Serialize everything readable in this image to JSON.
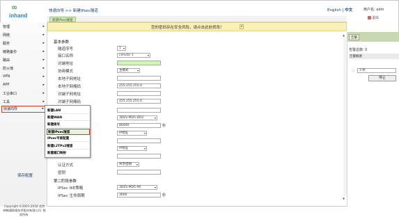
{
  "header": {
    "breadcrumb": "快速向导 >> 新建IPsec隧道",
    "tab": "新建IPsec隧道",
    "lang_en": "English",
    "lang_sep": "|",
    "lang_zh": "中文",
    "user": "用户名: adm",
    "logout": "退出"
  },
  "logo": {
    "mark": "∞",
    "brand": "inhand"
  },
  "warning": {
    "text": "您的密码存在安全风险，请点击此处修改！",
    "close": "×"
  },
  "sidebar": {
    "items": [
      {
        "label": "管理",
        "arrow": "▸"
      },
      {
        "label": "网络",
        "arrow": "▸"
      },
      {
        "label": "服务",
        "arrow": "▸"
      },
      {
        "label": "链路备份",
        "arrow": "▸"
      },
      {
        "label": "路由",
        "arrow": "▸"
      },
      {
        "label": "防火墙",
        "arrow": "▸"
      },
      {
        "label": "VPN",
        "arrow": "▸"
      },
      {
        "label": "APP",
        "arrow": "▸"
      },
      {
        "label": "工业串口",
        "arrow": "▸"
      },
      {
        "label": "工具",
        "arrow": "▸"
      },
      {
        "label": "快速向导",
        "arrow": "▸"
      }
    ],
    "save_config": "保存配置",
    "copyright": "Copyright ©2001-2018 北京映翰通网络技术股份有限公司. 版权所有."
  },
  "dropdown": {
    "items": [
      "新建LAN",
      "新建WAN",
      "新建拨号",
      "新建IPsec隧道",
      "IPsec专家配置",
      "新建L2TPv2隧道",
      "新建端口映射"
    ]
  },
  "form": {
    "basic_title": "基本参数",
    "tunnel_no_label": "隧道序号",
    "tunnel_no_value": "1",
    "iface_label": "接口名称",
    "iface_value": "cellular 1",
    "peer_addr_label": "对端地址",
    "negotiate_label": "协商模式",
    "negotiate_value": "主模式",
    "local_subnet_label": "本地子网地址",
    "local_mask_label": "本地子网掩码",
    "local_mask_value": "255.255.255.0",
    "peer_subnet_label": "对端子网地址",
    "peer_mask_label": "对端子网掩码",
    "peer_mask_value": "255.255.255.0",
    "ike_value": "3DES-MD5-DH2",
    "lifetime_value": "86400",
    "lifetime_unit": "秒",
    "id_type_1": "IP地址",
    "id_type_2": "IP地址",
    "auth_label": "认证方式",
    "auth_value": "共享密钥",
    "secret_label": "密钥",
    "phase2_title": "第二阶段参数",
    "ipsec_policy_label": "IPSec IKE策略",
    "ipsec_policy_value": "3DES-MD5-96",
    "ipsec_life_label": "IPSec 生命周期",
    "ipsec_life_value": "3600",
    "ipsec_life_unit": "秒"
  },
  "right_panel": {
    "tab": "告警",
    "count": "告警总数: 0",
    "overview": "告警概要",
    "interval": "3 秒",
    "stop": "停止"
  }
}
